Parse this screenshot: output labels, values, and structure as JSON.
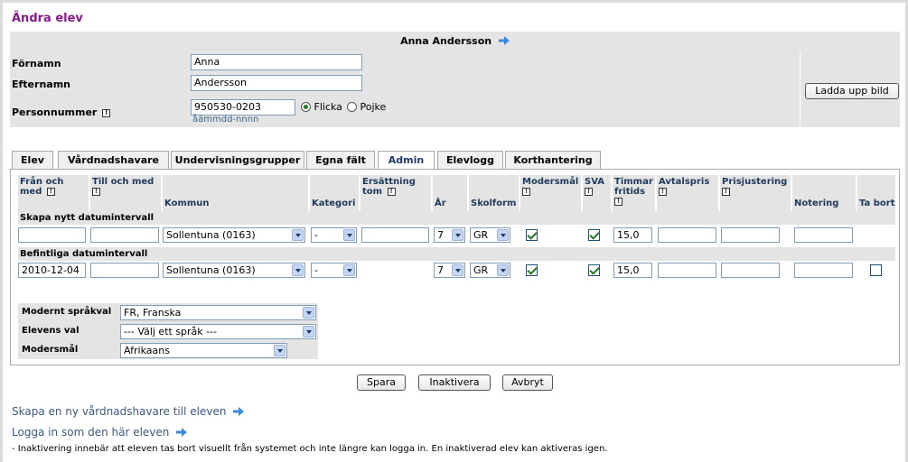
{
  "page": {
    "title": "Ändra elev"
  },
  "student": {
    "full_name": "Anna Andersson",
    "first_name_label": "Förnamn",
    "first_name": "Anna",
    "last_name_label": "Efternamn",
    "last_name": "Andersson",
    "pnr_label": "Personnummer",
    "pnr": "950530-0203",
    "pnr_hint": "åämmdd-nnnn",
    "gender_girl": "Flicka",
    "gender_boy": "Pojke",
    "upload_button": "Ladda upp bild"
  },
  "tabs": [
    {
      "label": "Elev"
    },
    {
      "label": "Vårdnadshavare"
    },
    {
      "label": "Undervisningsgrupper"
    },
    {
      "label": "Egna fält"
    },
    {
      "label": "Admin"
    },
    {
      "label": "Elevlogg"
    },
    {
      "label": "Korthantering"
    }
  ],
  "grid": {
    "headers": {
      "from": "Från och med",
      "to": "Till och med",
      "municipality": "Kommun",
      "category": "Kategori",
      "compensation": "Ersättning tom",
      "year": "År",
      "school_form": "Skolform",
      "mother_tongue": "Modersmål",
      "sva": "SVA",
      "leisure_hours": "Timmar fritids",
      "contract_price": "Avtalspris",
      "price_adjustment": "Prisjustering",
      "note": "Notering",
      "remove": "Ta bort"
    },
    "new_section": "Skapa nytt datumintervall",
    "existing_section": "Befintliga datumintervall",
    "new_row": {
      "from": "",
      "to": "",
      "municipality": "Sollentuna (0163)",
      "category": "-",
      "compensation": "",
      "year": "7",
      "school_form": "GR",
      "leisure_hours": "15,0",
      "contract_price": "",
      "price_adjustment": "",
      "note": ""
    },
    "existing_row": {
      "from": "2010-12-04",
      "to": "",
      "municipality": "Sollentuna (0163)",
      "category": "-",
      "year": "7",
      "school_form": "GR",
      "leisure_hours": "15,0",
      "contract_price": "",
      "price_adjustment": "",
      "note": ""
    }
  },
  "languages": {
    "modern_label": "Modernt språkval",
    "modern_value": "FR, Franska",
    "choice_label": "Elevens val",
    "choice_value": "--- Välj ett språk ---",
    "mother_label": "Modersmål",
    "mother_value": "Afrikaans"
  },
  "actions": {
    "save": "Spara",
    "deactivate": "Inaktivera",
    "cancel": "Avbryt"
  },
  "links": {
    "new_guardian": "Skapa en ny vårdnadshavare till eleven",
    "login_as": "Logga in som den här eleven"
  },
  "footnote": "- Inaktivering innebär att eleven tas bort visuellt från systemet och inte längre kan logga in. En inaktiverad elev kan aktiveras igen.",
  "colors": {
    "title": "#8b1a8b",
    "link": "#3a5a80",
    "arrow": "#3a8ad8"
  }
}
